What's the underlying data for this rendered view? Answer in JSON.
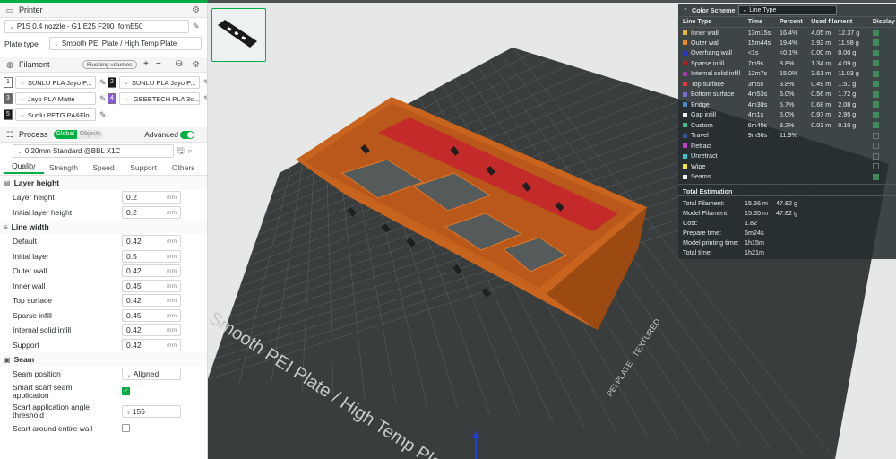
{
  "printer": {
    "title": "Printer",
    "profile": "P1S 0.4 nozzle - G1 E25 F200_fomE50",
    "plate_type_label": "Plate type",
    "plate_type": "Smooth PEI Plate / High Temp Plate"
  },
  "filament": {
    "title": "Filament",
    "flushing_label": "Flushing volumes",
    "items": [
      {
        "num": "1",
        "name": "SUNLU PLA Jayo P...",
        "color": "#ffffff",
        "num_color": "#262e30"
      },
      {
        "num": "2",
        "name": "SUNLU PLA Jayo P...",
        "color": "#1a1a1a",
        "num_color": "#ffffff"
      },
      {
        "num": "3",
        "name": "Jayo PLA Matte",
        "color": "#666666",
        "num_color": "#ffffff"
      },
      {
        "num": "4",
        "name": "GEEETECH PLA 3c...",
        "color": "#8a5bd6",
        "num_color": "#ffffff"
      },
      {
        "num": "5",
        "name": "Sunlu PETG PA&Flo...",
        "color": "#1a1a1a",
        "num_color": "#ffffff"
      }
    ]
  },
  "process": {
    "title": "Process",
    "global_label": "Global",
    "objects_label": "Objects",
    "advanced_label": "Advanced",
    "preset": "0.20mm Standard @BBL X1C",
    "tabs": [
      "Quality",
      "Strength",
      "Speed",
      "Support",
      "Others"
    ],
    "layer_height_group": "Layer height",
    "layer_height": {
      "label": "Layer height",
      "value": "0.2",
      "unit": "mm"
    },
    "initial_layer_height": {
      "label": "Initial layer height",
      "value": "0.2",
      "unit": "mm"
    },
    "line_width_group": "Line width",
    "line_widths": [
      {
        "label": "Default",
        "value": "0.42",
        "unit": "mm"
      },
      {
        "label": "Initial layer",
        "value": "0.5",
        "unit": "mm"
      },
      {
        "label": "Outer wall",
        "value": "0.42",
        "unit": "mm"
      },
      {
        "label": "Inner wall",
        "value": "0.45",
        "unit": "mm"
      },
      {
        "label": "Top surface",
        "value": "0.42",
        "unit": "mm"
      },
      {
        "label": "Sparse infill",
        "value": "0.45",
        "unit": "mm"
      },
      {
        "label": "Internal solid infill",
        "value": "0.42",
        "unit": "mm"
      },
      {
        "label": "Support",
        "value": "0.42",
        "unit": "mm"
      }
    ],
    "seam_group": "Seam",
    "seam_position": {
      "label": "Seam position",
      "value": "Aligned"
    },
    "smart_scarf": {
      "label_1": "Smart scarf seam",
      "label_2": "application"
    },
    "scarf_threshold": {
      "label_1": "Scarf application angle",
      "label_2": "threshold",
      "value": "155"
    },
    "scarf_around": {
      "label": "Scarf around entire wall"
    }
  },
  "viewport": {
    "plate_text": "Smooth PEI Plate / High Temp Plate",
    "side_label": "PEI PLATE · TEXTURED",
    "colors": {
      "model": "#c8641e",
      "model_dark": "#9c4a12",
      "infill": "#c42a2a",
      "bed": "#3a3d3e",
      "grid": "#5d6263",
      "bed_edge": "#2b2d2e"
    }
  },
  "color_scheme": {
    "title": "Color Scheme",
    "mode": "Line Type",
    "headers": [
      "Line Type",
      "Time",
      "Percent",
      "Used filament",
      "Display"
    ],
    "rows": [
      {
        "type": "Inner wall",
        "time": "13m15s",
        "percent": "16.4%",
        "m": "4.05 m",
        "g": "12.37 g",
        "color": "#e8b932",
        "on": true
      },
      {
        "type": "Outer wall",
        "time": "15m44s",
        "percent": "19.4%",
        "m": "3.92 m",
        "g": "11.98 g",
        "color": "#ee8a1f",
        "on": true
      },
      {
        "type": "Overhang wall",
        "time": "<1s",
        "percent": "<0.1%",
        "m": "0.00 m",
        "g": "0.00 g",
        "color": "#2a35c9",
        "on": true
      },
      {
        "type": "Sparse infill",
        "time": "7m9s",
        "percent": "8.8%",
        "m": "1.34 m",
        "g": "4.09 g",
        "color": "#b22222",
        "on": true
      },
      {
        "type": "Internal solid infill",
        "time": "12m7s",
        "percent": "15.0%",
        "m": "3.61 m",
        "g": "11.03 g",
        "color": "#a33aa8",
        "on": true
      },
      {
        "type": "Top surface",
        "time": "3m5s",
        "percent": "3.8%",
        "m": "0.49 m",
        "g": "1.51 g",
        "color": "#e23b3b",
        "on": true
      },
      {
        "type": "Bottom surface",
        "time": "4m53s",
        "percent": "6.0%",
        "m": "0.56 m",
        "g": "1.72 g",
        "color": "#7b6bd6",
        "on": true
      },
      {
        "type": "Bridge",
        "time": "4m38s",
        "percent": "5.7%",
        "m": "0.68 m",
        "g": "2.08 g",
        "color": "#4a86c9",
        "on": true
      },
      {
        "type": "Gap infill",
        "time": "4m1s",
        "percent": "5.0%",
        "m": "0.97 m",
        "g": "2.95 g",
        "color": "#f2f2f2",
        "on": true
      },
      {
        "type": "Custom",
        "time": "6m40s",
        "percent": "8.2%",
        "m": "0.03 m",
        "g": "0.10 g",
        "color": "#39c28a",
        "on": true
      },
      {
        "type": "Travel",
        "time": "9m36s",
        "percent": "11.9%",
        "m": "",
        "g": "",
        "color": "#3a4fa0",
        "on": false
      },
      {
        "type": "Retract",
        "time": "",
        "percent": "",
        "m": "",
        "g": "",
        "color": "#c03bd0",
        "on": false
      },
      {
        "type": "Unretract",
        "time": "",
        "percent": "",
        "m": "",
        "g": "",
        "color": "#3bc0d0",
        "on": false
      },
      {
        "type": "Wipe",
        "time": "",
        "percent": "",
        "m": "",
        "g": "",
        "color": "#f2e23b",
        "on": false
      },
      {
        "type": "Seams",
        "time": "",
        "percent": "",
        "m": "",
        "g": "",
        "color": "#f2f2f2",
        "on": true
      }
    ],
    "total_title": "Total Estimation",
    "totals": [
      {
        "k": "Total Filament:",
        "v1": "15.66 m",
        "v2": "47.82 g"
      },
      {
        "k": "Model Filament:",
        "v1": "15.65 m",
        "v2": "47.82 g"
      },
      {
        "k": "Cost:",
        "v1": "1.82",
        "v2": ""
      },
      {
        "k": "Prepare time:",
        "v1": "6m24s",
        "v2": ""
      },
      {
        "k": "Model printing time:",
        "v1": "1h15m",
        "v2": ""
      },
      {
        "k": "Total time:",
        "v1": "1h21m",
        "v2": ""
      }
    ]
  }
}
